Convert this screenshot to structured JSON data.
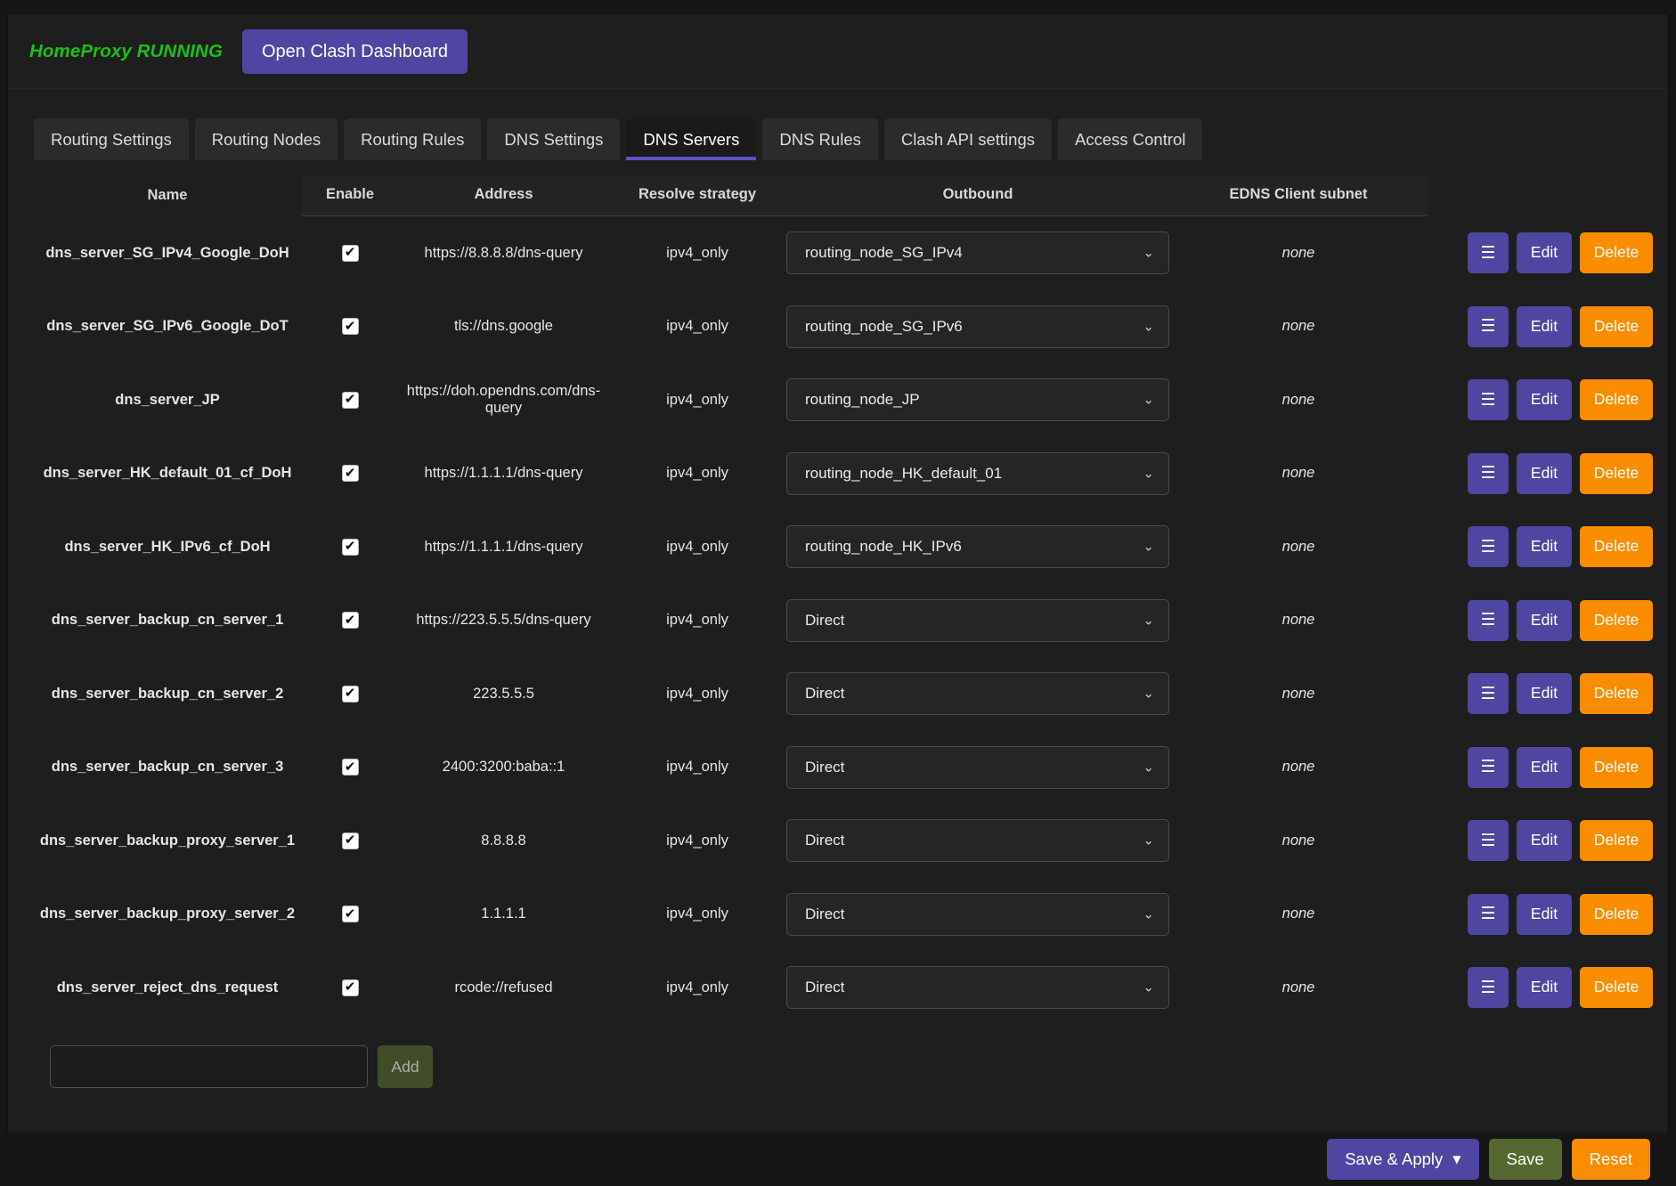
{
  "header": {
    "status_label": "HomeProxy RUNNING",
    "status_color": "#19c119",
    "dashboard_button": "Open Clash Dashboard",
    "accent_purple": "#4e46a0",
    "accent_orange": "#fa8c00",
    "accent_green": "#55682f"
  },
  "tabs": [
    {
      "label": "Routing Settings",
      "active": false
    },
    {
      "label": "Routing Nodes",
      "active": false
    },
    {
      "label": "Routing Rules",
      "active": false
    },
    {
      "label": "DNS Settings",
      "active": false
    },
    {
      "label": "DNS Servers",
      "active": true
    },
    {
      "label": "DNS Rules",
      "active": false
    },
    {
      "label": "Clash API settings",
      "active": false
    },
    {
      "label": "Access Control",
      "active": false
    }
  ],
  "table": {
    "columns": [
      "Name",
      "Enable",
      "Address",
      "Resolve strategy",
      "Outbound",
      "EDNS Client subnet",
      ""
    ],
    "row_actions": {
      "handle_icon": "hamburger-icon",
      "handle_glyph": "☰",
      "edit_label": "Edit",
      "delete_label": "Delete"
    },
    "select_caret_glyph": "⌄",
    "rows": [
      {
        "name": "dns_server_SG_IPv4_Google_DoH",
        "enabled": true,
        "address": "https://8.8.8.8/dns-query",
        "resolve": "ipv4_only",
        "outbound": "routing_node_SG_IPv4",
        "edns": "none"
      },
      {
        "name": "dns_server_SG_IPv6_Google_DoT",
        "enabled": true,
        "address": "tls://dns.google",
        "resolve": "ipv4_only",
        "outbound": "routing_node_SG_IPv6",
        "edns": "none"
      },
      {
        "name": "dns_server_JP",
        "enabled": true,
        "address": "https://doh.opendns.com/dns-query",
        "resolve": "ipv4_only",
        "outbound": "routing_node_JP",
        "edns": "none"
      },
      {
        "name": "dns_server_HK_default_01_cf_DoH",
        "enabled": true,
        "address": "https://1.1.1.1/dns-query",
        "resolve": "ipv4_only",
        "outbound": "routing_node_HK_default_01",
        "edns": "none"
      },
      {
        "name": "dns_server_HK_IPv6_cf_DoH",
        "enabled": true,
        "address": "https://1.1.1.1/dns-query",
        "resolve": "ipv4_only",
        "outbound": "routing_node_HK_IPv6",
        "edns": "none"
      },
      {
        "name": "dns_server_backup_cn_server_1",
        "enabled": true,
        "address": "https://223.5.5.5/dns-query",
        "resolve": "ipv4_only",
        "outbound": "Direct",
        "edns": "none"
      },
      {
        "name": "dns_server_backup_cn_server_2",
        "enabled": true,
        "address": "223.5.5.5",
        "resolve": "ipv4_only",
        "outbound": "Direct",
        "edns": "none"
      },
      {
        "name": "dns_server_backup_cn_server_3",
        "enabled": true,
        "address": "2400:3200:baba::1",
        "resolve": "ipv4_only",
        "outbound": "Direct",
        "edns": "none"
      },
      {
        "name": "dns_server_backup_proxy_server_1",
        "enabled": true,
        "address": "8.8.8.8",
        "resolve": "ipv4_only",
        "outbound": "Direct",
        "edns": "none"
      },
      {
        "name": "dns_server_backup_proxy_server_2",
        "enabled": true,
        "address": "1.1.1.1",
        "resolve": "ipv4_only",
        "outbound": "Direct",
        "edns": "none"
      },
      {
        "name": "dns_server_reject_dns_request",
        "enabled": true,
        "address": "rcode://refused",
        "resolve": "ipv4_only",
        "outbound": "Direct",
        "edns": "none"
      }
    ]
  },
  "add_row": {
    "input_value": "",
    "input_placeholder": "",
    "button_label": "Add"
  },
  "footer": {
    "save_apply_label": "Save & Apply",
    "save_apply_caret": "▼",
    "save_label": "Save",
    "reset_label": "Reset"
  }
}
